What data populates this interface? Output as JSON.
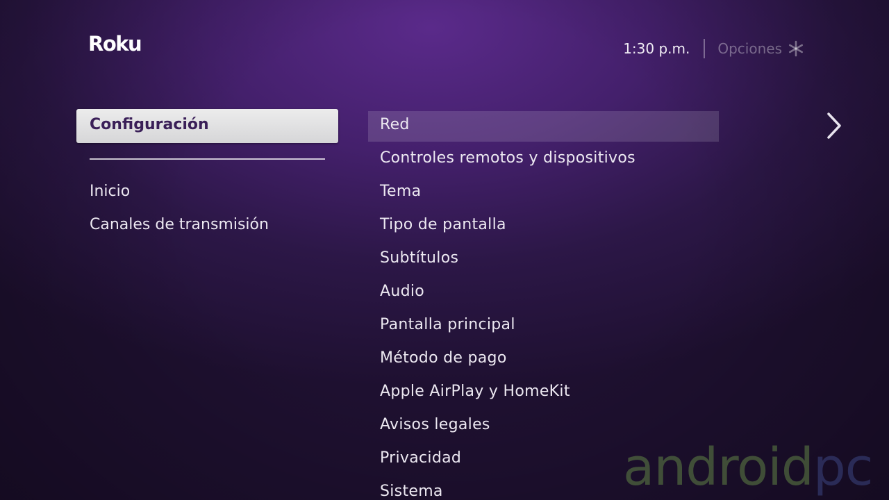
{
  "header": {
    "logo": "Roku",
    "time": "1:30 p.m.",
    "options_label": "Opciones",
    "options_icon": "asterisk-icon"
  },
  "nav": {
    "selected": "Configuración",
    "items": [
      "Inicio",
      "Canales de transmisión"
    ]
  },
  "settings": {
    "items": [
      "Red",
      "Controles remotos y dispositivos",
      "Tema",
      "Tipo de pantalla",
      "Subtítulos",
      "Audio",
      "Pantalla principal",
      "Método de pago",
      "Apple AirPlay y HomeKit",
      "Avisos legales",
      "Privacidad",
      "Sistema"
    ],
    "selected_index": 0
  },
  "watermark": {
    "part1": "android",
    "part2": "pc"
  },
  "colors": {
    "background": "#44206c",
    "selected_text": "#3a1f58",
    "watermark_green": "#608446",
    "watermark_blue": "#3c4682"
  }
}
